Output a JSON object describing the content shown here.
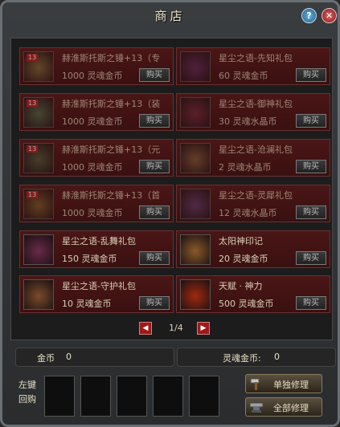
{
  "window": {
    "title": "商店"
  },
  "items": [
    {
      "name": "赫淮斯托斯之锤+13（专",
      "price": "1000 灵魂金币",
      "buy": "购买",
      "icon": "hammer-icon",
      "color": "#7a6a3a",
      "badge": "13",
      "faded": true
    },
    {
      "name": "星尘之语-先知礼包",
      "price": "60 灵魂金币",
      "buy": "购买",
      "icon": "bag-icon",
      "color": "#5a2a5a",
      "faded": true
    },
    {
      "name": "赫淮斯托斯之锤+13（装",
      "price": "1000 灵魂金币",
      "buy": "购买",
      "icon": "hammer-icon",
      "color": "#4a6a4a",
      "badge": "13",
      "faded": true
    },
    {
      "name": "星尘之语-御神礼包",
      "price": "30 灵魂水晶币",
      "buy": "购买",
      "icon": "bag-icon",
      "color": "#6a2a3a",
      "faded": true
    },
    {
      "name": "赫淮斯托斯之锤+13（元",
      "price": "1000 灵魂金币",
      "buy": "购买",
      "icon": "hammer-icon",
      "color": "#4a5a3a",
      "badge": "13",
      "faded": true
    },
    {
      "name": "星尘之语-沧澜礼包",
      "price": "2 灵魂水晶币",
      "buy": "购买",
      "icon": "bag-icon",
      "color": "#7a5a3a",
      "faded": true
    },
    {
      "name": "赫淮斯托斯之锤+13（首",
      "price": "1000 灵魂金币",
      "buy": "购买",
      "icon": "hammer-icon",
      "color": "#7a5a2a",
      "badge": "13",
      "faded": true
    },
    {
      "name": "星尘之语-灵犀礼包",
      "price": "12 灵魂水晶币",
      "buy": "购买",
      "icon": "bag-icon",
      "color": "#5a3a6a",
      "faded": true
    },
    {
      "name": "星尘之语-乱舞礼包",
      "price": "150 灵魂金币",
      "buy": "购买",
      "icon": "bag-icon",
      "color": "#6a2a4a",
      "faded": false
    },
    {
      "name": "太阳神印记",
      "price": "20 灵魂金币",
      "buy": "购买",
      "icon": "sun-seal-icon",
      "color": "#8a5a2a",
      "faded": false
    },
    {
      "name": "星尘之语-守护礼包",
      "price": "10 灵魂金币",
      "buy": "购买",
      "icon": "bag-icon",
      "color": "#7a4a2a",
      "faded": false
    },
    {
      "name": "天赋 · 神力",
      "price": "500 灵魂金币",
      "buy": "购买",
      "icon": "flame-icon",
      "color": "#a02a10",
      "faded": false
    }
  ],
  "pager": {
    "prev": "◀",
    "next": "▶",
    "text": "1/4"
  },
  "currency": {
    "gold_label": "金币",
    "gold_value": "0",
    "soul_label": "灵魂金币:",
    "soul_value": "0"
  },
  "buyback": {
    "label": "左键回购"
  },
  "buttons": {
    "repair_single": "单独修理",
    "repair_all": "全部修理"
  },
  "colors": {
    "accent_red": "#b42020",
    "border_red": "#6a3030"
  }
}
